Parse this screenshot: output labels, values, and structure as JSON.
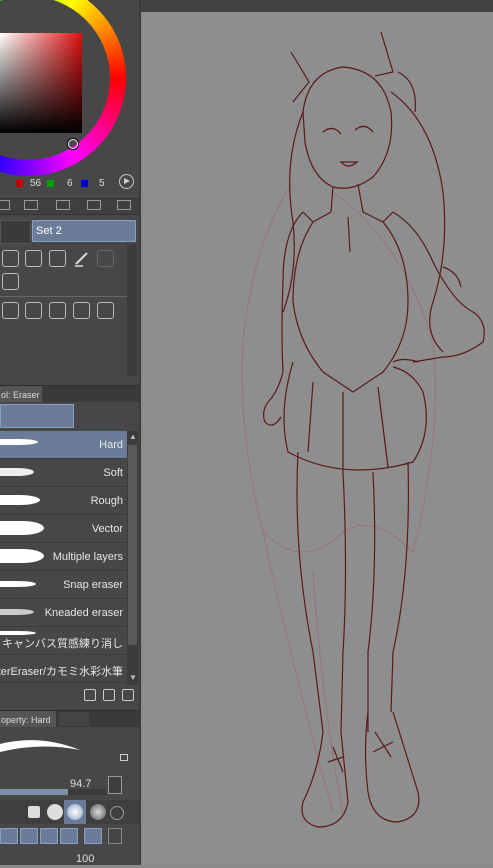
{
  "color": {
    "r_value": "56",
    "g_value": "6",
    "b_value": "5",
    "current_color": "#380605"
  },
  "sub_tool": {
    "set_label": "Set 2"
  },
  "eraser_panel": {
    "title": "ol: Eraser",
    "items": [
      {
        "label": "Hard",
        "selected": true
      },
      {
        "label": "Soft",
        "selected": false
      },
      {
        "label": "Rough",
        "selected": false
      },
      {
        "label": "Vector",
        "selected": false
      },
      {
        "label": "Multiple layers",
        "selected": false
      },
      {
        "label": "Snap eraser",
        "selected": false
      },
      {
        "label": "Kneaded eraser",
        "selected": false
      },
      {
        "label": "ミキャンバス質感練り消し",
        "selected": false
      },
      {
        "label": "aterEraser/カモミ水彩水筆",
        "selected": false
      }
    ]
  },
  "property_panel": {
    "title": "operty: Hard",
    "brush_size": "94.7",
    "bottom_value": "100"
  },
  "canvas": {
    "background": "#8e8e8e",
    "line_color": "#5a1a1a"
  }
}
